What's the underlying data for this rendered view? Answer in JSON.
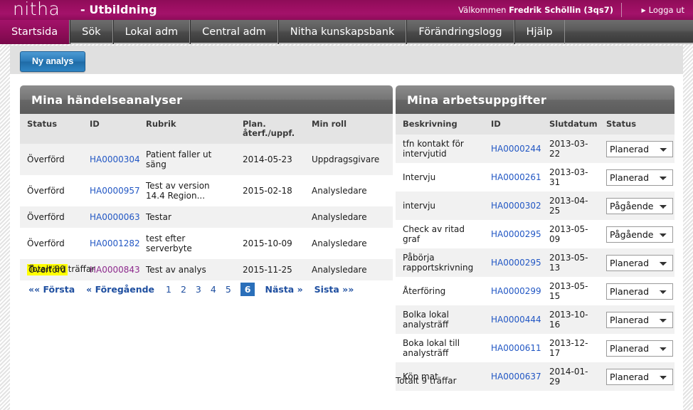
{
  "brand": {
    "logo": "nitha",
    "subtitle": "- Utbildning",
    "welcome_prefix": "Välkommen",
    "user": "Fredrik Schöllin (3qs7)",
    "logout": "Logga ut",
    "bar_color": "#9c0e62"
  },
  "nav": {
    "tabs": [
      {
        "label": "Startsida",
        "active": true
      },
      {
        "label": "Sök",
        "active": false
      },
      {
        "label": "Lokal adm",
        "active": false
      },
      {
        "label": "Central adm",
        "active": false
      },
      {
        "label": "Nitha kunskapsbank",
        "active": false
      },
      {
        "label": "Förändringslogg",
        "active": false
      },
      {
        "label": "Hjälp",
        "active": false
      }
    ],
    "active_color": "#8e0c58"
  },
  "toolbar": {
    "new_analysis_label": "Ny analys",
    "button_color": "#2a7ab8"
  },
  "analyses": {
    "title": "Mina händelseanalyser",
    "columns": [
      "Status",
      "ID",
      "Rubrik",
      "Plan. återf./uppf.",
      "Min roll"
    ],
    "column_0": "Status",
    "column_1": "ID",
    "column_2": "Rubrik",
    "column_3_line1": "Plan.",
    "column_3_line2": "återf./uppf.",
    "column_4": "Min roll",
    "rows": [
      {
        "status": "Överförd",
        "id": "HA0000304",
        "rubrik": "Patient faller ut säng",
        "plan": "2014-05-23",
        "roll": "Uppdragsgivare",
        "highlight": false,
        "visited": false
      },
      {
        "status": "Överförd",
        "id": "HA0000957",
        "rubrik": "Test av version 14.4 Region...",
        "plan": "2015-02-18",
        "roll": "Analysledare",
        "highlight": false,
        "visited": false
      },
      {
        "status": "Överförd",
        "id": "HA0000063",
        "rubrik": "Testar",
        "plan": "",
        "roll": "Analysledare",
        "highlight": false,
        "visited": false
      },
      {
        "status": "Överförd",
        "id": "HA0001282",
        "rubrik": "test efter serverbyte",
        "plan": "2015-10-09",
        "roll": "Analysledare",
        "highlight": false,
        "visited": false
      },
      {
        "status": "Överförd",
        "id": "HA0000843",
        "rubrik": "Test av analys",
        "plan": "2015-11-25",
        "roll": "Analysledare",
        "highlight": true,
        "visited": true
      }
    ],
    "total": "Totalt 80 träffar",
    "pager": {
      "first": "«« Första",
      "prev": "« Föregående",
      "numbers": [
        "1",
        "2",
        "3",
        "4",
        "5"
      ],
      "current": "6",
      "next": "Nästa »",
      "last": "Sista »»"
    }
  },
  "tasks": {
    "title": "Mina arbetsuppgifter",
    "column_0": "Beskrivning",
    "column_1": "ID",
    "column_2": "Slutdatum",
    "column_3": "Status",
    "status_options": [
      "Planerad",
      "Pågående"
    ],
    "rows": [
      {
        "beskrivning": "tfn kontakt för intervjutid",
        "id": "HA0000244",
        "slutdatum": "2013-03-22",
        "status": "Planerad"
      },
      {
        "beskrivning": "Intervju",
        "id": "HA0000261",
        "slutdatum": "2013-03-31",
        "status": "Planerad"
      },
      {
        "beskrivning": "intervju",
        "id": "HA0000302",
        "slutdatum": "2013-04-25",
        "status": "Pågående"
      },
      {
        "beskrivning": "Check av ritad graf",
        "id": "HA0000295",
        "slutdatum": "2013-05-09",
        "status": "Pågående"
      },
      {
        "beskrivning": "Påbörja rapportskrivning",
        "id": "HA0000295",
        "slutdatum": "2013-05-13",
        "status": "Planerad"
      },
      {
        "beskrivning": "Återföring",
        "id": "HA0000299",
        "slutdatum": "2013-05-15",
        "status": "Planerad"
      },
      {
        "beskrivning": "Bolka lokal analysträff",
        "id": "HA0000444",
        "slutdatum": "2013-10-16",
        "status": "Planerad"
      },
      {
        "beskrivning": "Boka lokal till analysträff",
        "id": "HA0000611",
        "slutdatum": "2013-12-17",
        "status": "Planerad"
      },
      {
        "beskrivning": "Köp mat",
        "id": "HA0000637",
        "slutdatum": "2014-01-29",
        "status": "Planerad"
      }
    ],
    "total": "Totalt 9 träffar"
  }
}
